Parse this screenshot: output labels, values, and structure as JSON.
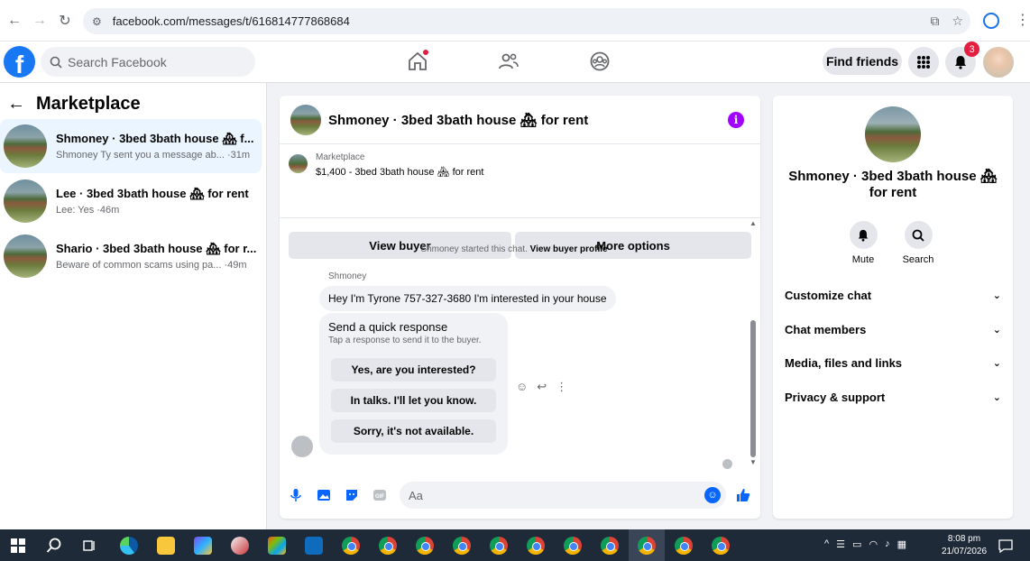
{
  "browser": {
    "url": "facebook.com/messages/t/616814777868684"
  },
  "header": {
    "logo": "f",
    "search_placeholder": "Search Facebook",
    "find_friends": "Find friends",
    "notification_count": "3"
  },
  "sidebar": {
    "title": "Marketplace",
    "conversations": [
      {
        "title": "Shmoney · 3bed 3bath house 🏘 f...",
        "subtitle": "Shmoney Ty sent you a message ab... ·31m"
      },
      {
        "title": "Lee · 3bed 3bath house 🏘 for rent",
        "subtitle": "Lee: Yes ·46m"
      },
      {
        "title": "Shario · 3bed 3bath house 🏘 for r...",
        "subtitle": "Beware of common scams using pa... ·49m"
      }
    ]
  },
  "chat": {
    "title": "Shmoney · 3bed 3bath house 🏘 for rent",
    "listing_label": "Marketplace",
    "listing_price": "$1,400 - 3bed 3bath house 🏘 for rent",
    "view_buyer": "View buyer",
    "more_options": "More options",
    "system_message": "Shmoney started this chat.",
    "view_buyer_profile": "View buyer profile",
    "sender": "Shmoney",
    "message": "Hey I'm Tyrone 757-327-3680 I'm interested in your house",
    "quick_title": "Send a quick response",
    "quick_sub": "Tap a response to send it to the buyer.",
    "quick_responses": [
      "Yes, are you interested?",
      "In talks. I'll let you know.",
      "Sorry, it's not available."
    ],
    "input_placeholder": "Aa"
  },
  "details": {
    "title": "Shmoney · 3bed 3bath house 🏘 for rent",
    "mute": "Mute",
    "search": "Search",
    "sections": [
      "Customize chat",
      "Chat members",
      "Media, files and links",
      "Privacy & support"
    ]
  },
  "taskbar": {
    "time": "8:08 pm",
    "date": "21/07/2026"
  },
  "colors": {
    "facebook_blue": "#1877f2",
    "messenger_blue": "#0866ff",
    "badge_red": "#e41e3f",
    "info_purple": "#a200ff"
  }
}
